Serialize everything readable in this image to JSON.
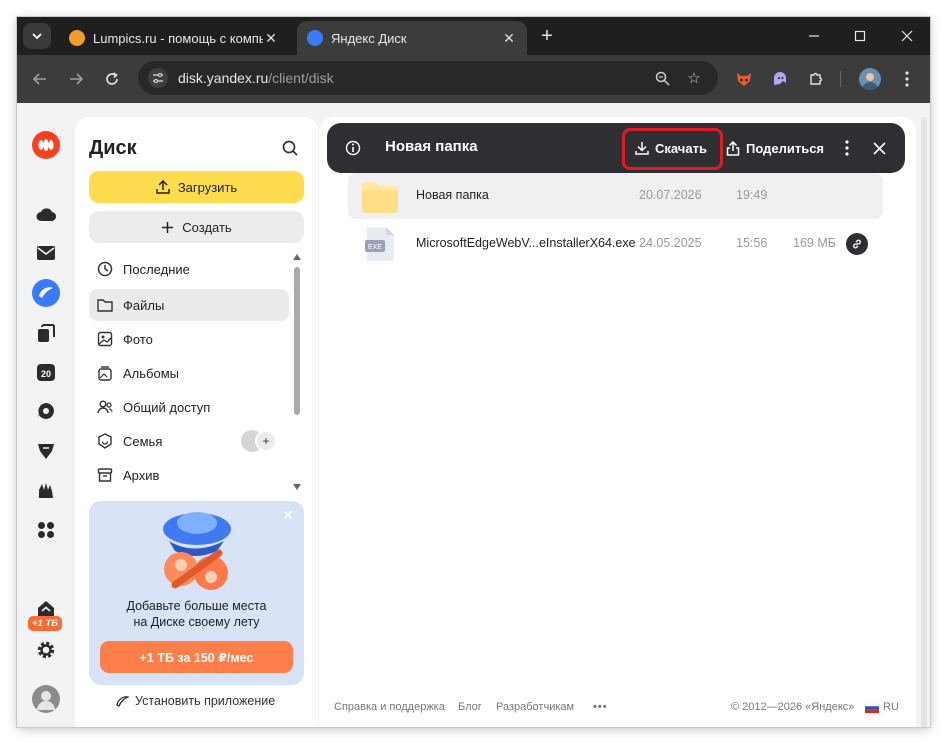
{
  "browser": {
    "tabs": [
      {
        "title": "Lumpics.ru - помощь с компью",
        "favicon": "orange-circle"
      },
      {
        "title": "Яндекс Диск",
        "favicon": "yandex-disk"
      }
    ],
    "new_tab": "+",
    "url_domain": "disk.yandex.ru",
    "url_path": "/client/disk"
  },
  "sidebar": {
    "title": "Диск",
    "upload_label": "Загрузить",
    "create_label": "Создать",
    "nav": [
      {
        "label": "Последние",
        "icon": "clock-icon"
      },
      {
        "label": "Файлы",
        "icon": "folder-icon"
      },
      {
        "label": "Фото",
        "icon": "photo-icon"
      },
      {
        "label": "Альбомы",
        "icon": "album-icon"
      },
      {
        "label": "Общий доступ",
        "icon": "people-icon"
      },
      {
        "label": "Семья",
        "icon": "family-icon"
      },
      {
        "label": "Архив",
        "icon": "archive-icon"
      }
    ],
    "promo": {
      "line1": "Добавьте больше места",
      "line2": "на Диске своему лету",
      "button": "+1 ТБ за 150 ₽/мес"
    },
    "install_app": "Установить приложение"
  },
  "rail": {
    "badge_day": "20",
    "plus_badge": "+1 ТБ"
  },
  "actionbar": {
    "title": "Новая папка",
    "download": "Скачать",
    "share": "Поделиться"
  },
  "files": [
    {
      "name": "Новая папка",
      "date": "20.07.2026",
      "time": "19:49",
      "size": "",
      "type": "folder"
    },
    {
      "name": "MicrosoftEdgeWebV...eInstallerX64.exe",
      "date": "24.05.2025",
      "time": "15:56",
      "size": "169 МБ",
      "type": "exe",
      "type_label": "EXE"
    }
  ],
  "footer": {
    "help": "Справка и поддержка",
    "blog": "Блог",
    "developers": "Разработчикам",
    "more": "•••",
    "copyright": "© 2012—2026 «Яндекс»",
    "lang": "RU"
  },
  "colors": {
    "accent_yellow": "#ffdc4d",
    "promo_orange": "#ff7e4a",
    "highlight_red": "#e01b24",
    "actionbar_dark": "#2f2f33"
  }
}
